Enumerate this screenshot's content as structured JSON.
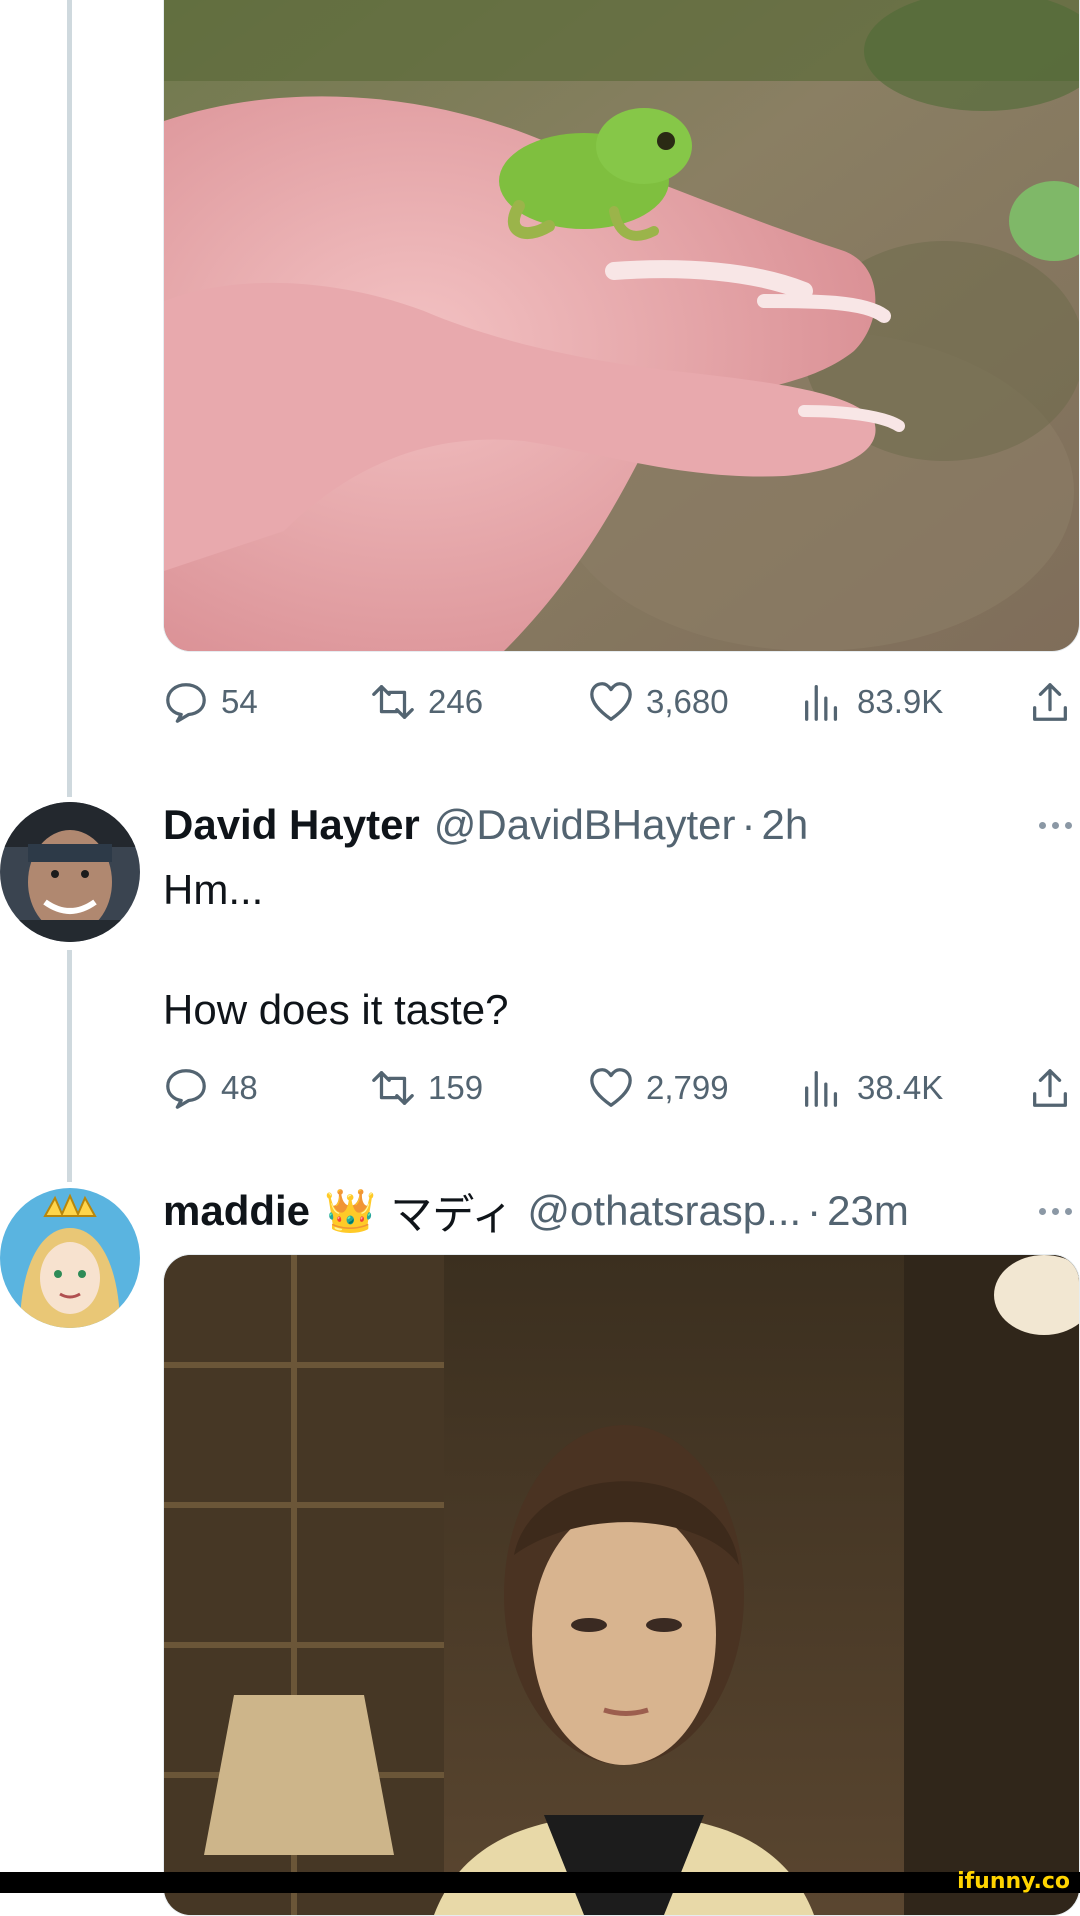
{
  "tweet1": {
    "media_alt": "tiny green frog on fingertips",
    "stats": {
      "replies": "54",
      "reposts": "246",
      "likes": "3,680",
      "views": "83.9K"
    }
  },
  "tweet2": {
    "name": "David Hayter",
    "handle": "@DavidBHayter",
    "dot": "·",
    "time": "2h",
    "text_line1": "Hm...",
    "text_line2": "How does it taste?",
    "stats": {
      "replies": "48",
      "reposts": "159",
      "likes": "2,799",
      "views": "38.4K"
    }
  },
  "tweet3": {
    "name": "maddie",
    "name_emoji": "👑",
    "name_jp": "マディ",
    "handle": "@othatsrasp...",
    "dot": "·",
    "time": "23m"
  },
  "watermark": "ifunny.co",
  "icons": [
    "reply-icon",
    "repost-icon",
    "like-icon",
    "views-icon",
    "share-icon",
    "more-icon"
  ],
  "colors": {
    "text": "#0f1419",
    "secondary": "#536471",
    "thread_line": "#cfd9de"
  }
}
